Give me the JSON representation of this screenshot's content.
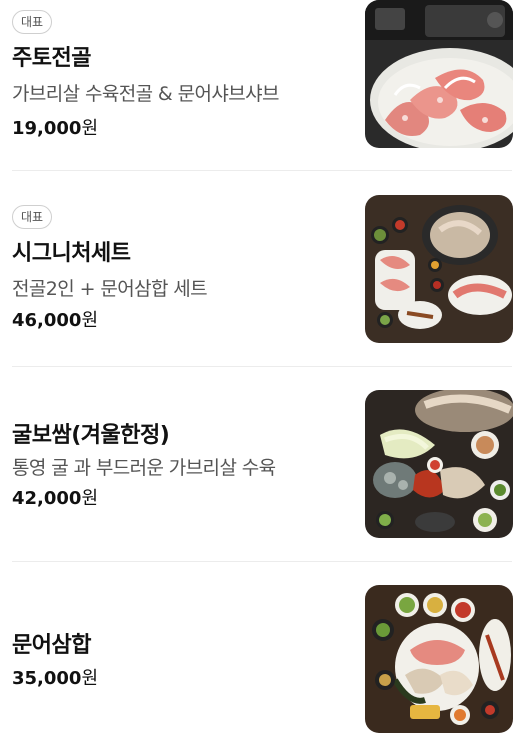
{
  "menu": {
    "items": [
      {
        "badge": "대표",
        "name": "주토전골",
        "description": "가브리살 수육전골 & 문어샤브샤브",
        "price": "19,000",
        "currency": "원",
        "image": "octopus-shabu-platter"
      },
      {
        "badge": "대표",
        "name": "시그니처세트",
        "description": "전골2인 + 문어삼합 세트",
        "price": "46,000",
        "currency": "원",
        "image": "signature-set-spread"
      },
      {
        "name": "굴보쌈(겨울한정)",
        "description": "통영 굴 과 부드러운 가브리살 수육",
        "price": "42,000",
        "currency": "원",
        "image": "oyster-bossam-spread"
      },
      {
        "name": "문어삼합",
        "price": "35,000",
        "currency": "원",
        "image": "octopus-samhap-spread"
      }
    ]
  }
}
